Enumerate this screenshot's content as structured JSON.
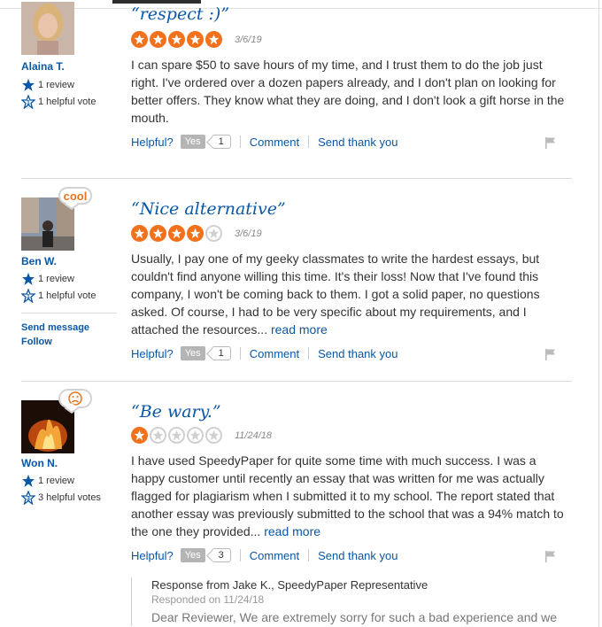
{
  "labels": {
    "helpful": "Helpful?",
    "yes": "Yes",
    "comment": "Comment",
    "send_thank_you": "Send thank you",
    "read_more": "read more",
    "send_message": "Send message",
    "follow": "Follow"
  },
  "colors": {
    "accent": "#0a57a5",
    "star": "#f2711c",
    "badge": "#e8741e"
  },
  "reviews": [
    {
      "user": {
        "name": "Alaina T.",
        "reviews": "1 review",
        "helpful_votes": "1 helpful vote"
      },
      "title": "“respect :)”",
      "rating": 5,
      "date": "3/6/19",
      "text": "I can spare $50 to save hours of my time, and I trust them to do the job just right. I've ordered over a dozen papers already, and I don't plan on looking for better offers. They know what they are doing, and I don't look a gift horse in the mouth.",
      "yes_count": "1"
    },
    {
      "user": {
        "name": "Ben W.",
        "reviews": "1 review",
        "helpful_votes": "1 helpful vote",
        "badge": "cool"
      },
      "title": "“Nice alternative”",
      "rating": 4,
      "date": "3/6/19",
      "text": "Usually, I pay one of my geeky classmates to write the hardest essays, but couldn't find anyone willing this time. It's their loss! Now that I've found this company, I won't be coming back to them. I got a solid paper, no questions asked. Of course, I had to be very specific about my requirements, and I attached the resources...",
      "yes_count": "1"
    },
    {
      "user": {
        "name": "Won N.",
        "reviews": "1 review",
        "helpful_votes": "3 helpful votes",
        "badge_icon": "sad-face-icon"
      },
      "title": "“Be wary.”",
      "rating": 1,
      "date": "11/24/18",
      "text": "I have used SpeedyPaper for quite some time with much success. I was a happy customer until recently an essay that was written for me was actually flagged for plagiarism when I submitted it to my school. The report stated that another essay was previously submitted to the school that was a 94% match to the one they provided...",
      "yes_count": "3",
      "response": {
        "header": "Response from Jake K., SpeedyPaper Representative",
        "date": "Responded on 11/24/18",
        "text": "Dear Reviewer, We are extremely sorry for such a bad experience and we"
      }
    }
  ]
}
